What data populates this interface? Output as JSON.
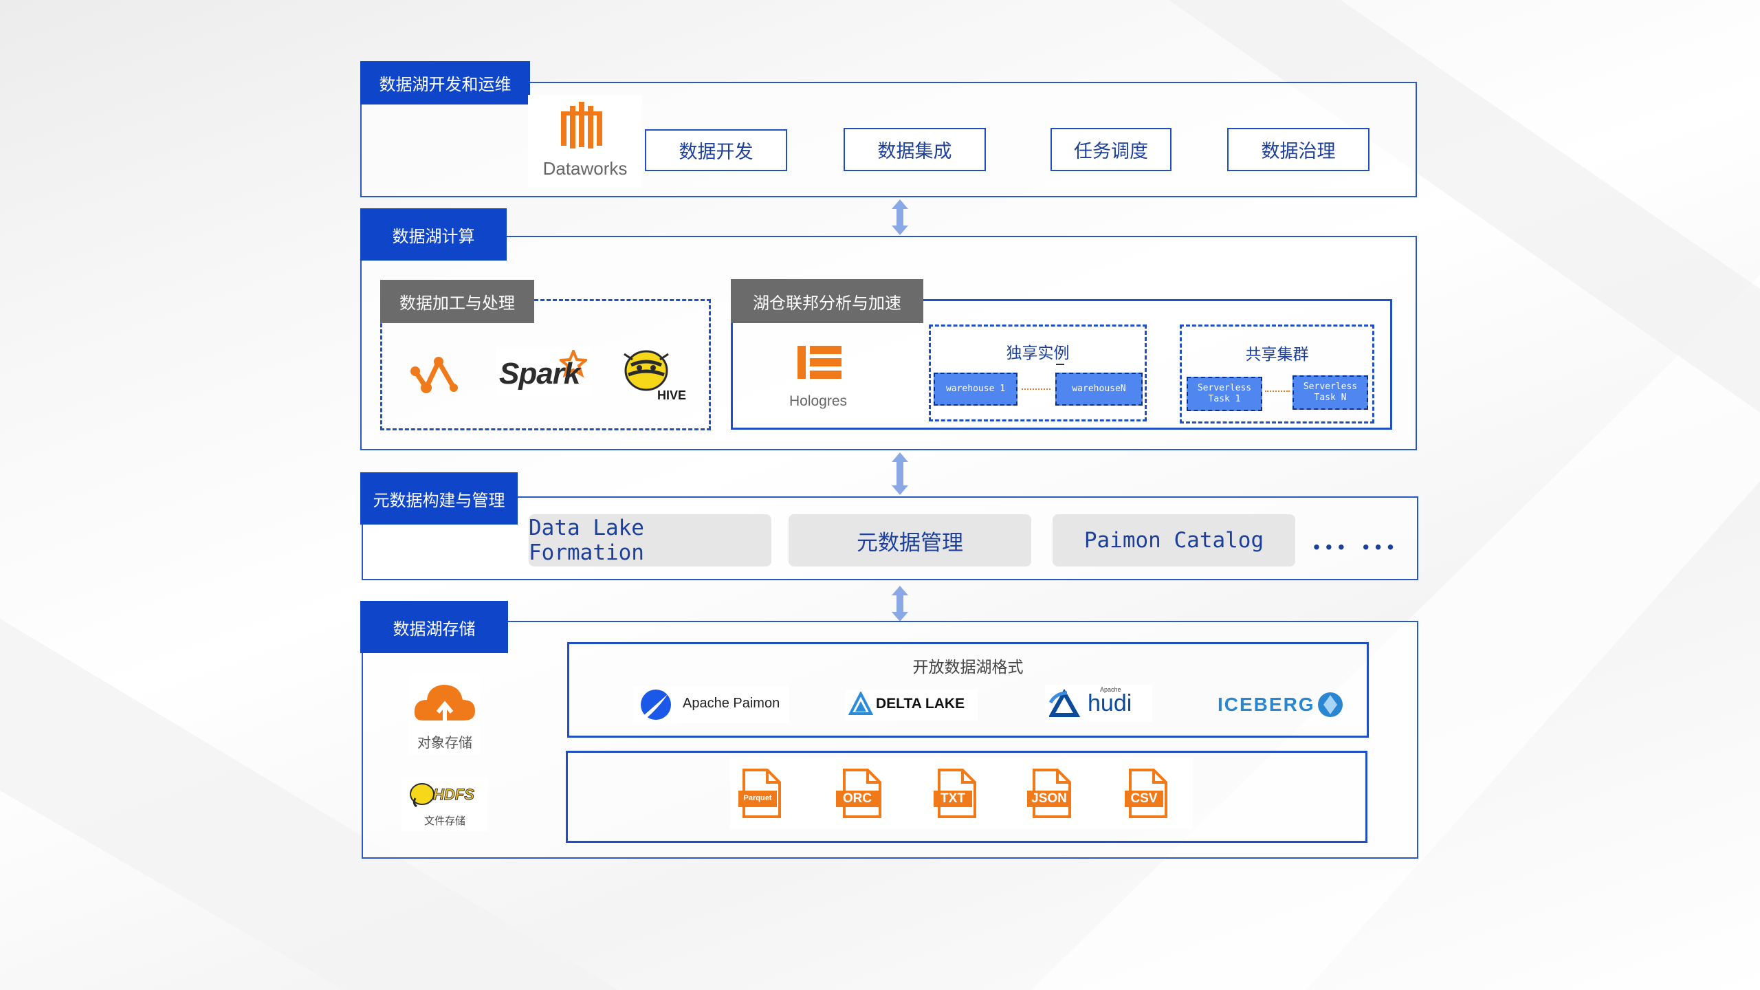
{
  "layers": {
    "devops": {
      "tab": "数据湖开发和运维",
      "logo_label": "Dataworks",
      "items": [
        "数据开发",
        "数据集成",
        "任务调度",
        "数据治理"
      ]
    },
    "compute": {
      "tab": "数据湖计算",
      "processing": {
        "title": "数据加工与处理",
        "spark_label": "Spark",
        "hive_label": "HIVE"
      },
      "federation": {
        "title": "湖仓联邦分析与加速",
        "hologres_label": "Hologres",
        "exclusive": {
          "title": "独享实例",
          "box1": "warehouse 1",
          "box2": "warehouseN"
        },
        "shared": {
          "title": "共享集群",
          "box1_line1": "Serverless",
          "box1_line2": "Task 1",
          "box2_line1": "Serverless",
          "box2_line2": "Task N"
        }
      }
    },
    "metadata": {
      "tab": "元数据构建与管理",
      "items": [
        "Data Lake Formation",
        "元数据管理",
        "Paimon Catalog"
      ],
      "ellipsis": "... ..."
    },
    "storage": {
      "tab": "数据湖存储",
      "object_storage": "对象存储",
      "hdfs_label": "HDFS",
      "hdfs_caption": "文件存储",
      "formats_title": "开放数据湖格式",
      "formats": [
        "Apache Paimon",
        "DELTA LAKE",
        "hudi",
        "ICEBERG"
      ],
      "hudi_prefix": "Apache",
      "file_types": [
        "Parquet",
        "ORC",
        "TXT",
        "JSON",
        "CSV"
      ]
    }
  },
  "colors": {
    "primary": "#0f45c8",
    "border": "#2a56c6",
    "arrow": "#8aa8e6",
    "orange": "#f07a1a"
  }
}
